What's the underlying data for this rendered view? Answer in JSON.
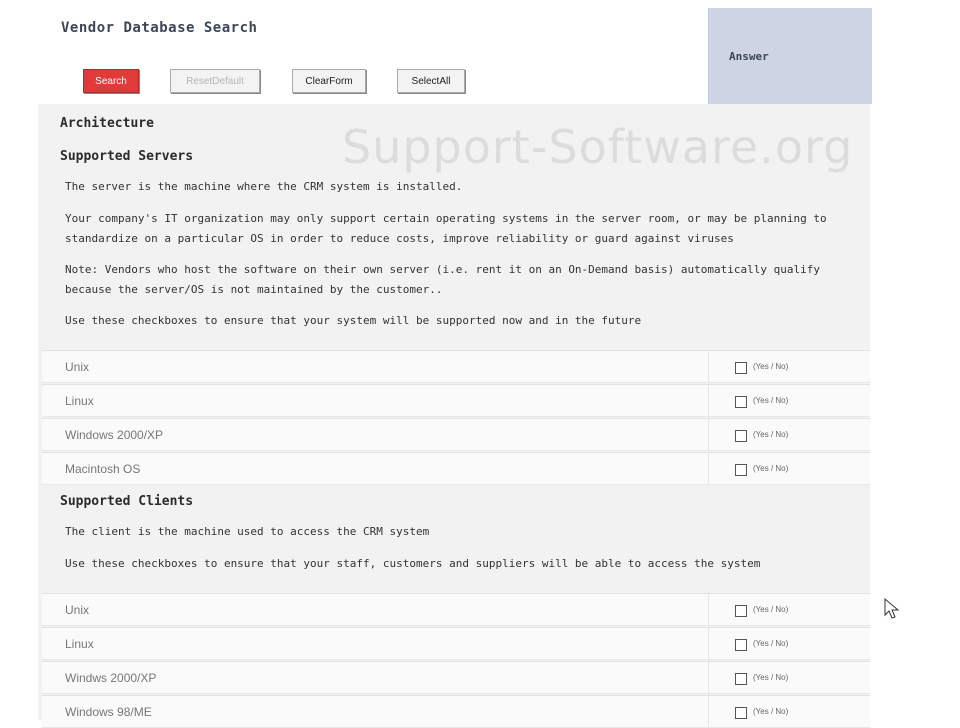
{
  "header": {
    "title": "Vendor Database Search",
    "answer_label": "Answer"
  },
  "toolbar": {
    "search_label": "Search",
    "reset_label": "ResetDefault",
    "clear_label": "ClearForm",
    "select_label": "SelectAll"
  },
  "watermark": "Support-Software.org",
  "architecture": {
    "title": "Architecture"
  },
  "servers": {
    "title": "Supported Servers",
    "para1": "The server is the machine where the CRM system is installed.",
    "para2": "Your company's IT organization may only support certain operating systems in the server room, or may be planning to standardize on a particular OS in order to reduce costs, improve reliability or guard against viruses",
    "para3": "Note: Vendors who host the software on their own server (i.e. rent it on an On-Demand basis) automatically qualify because the server/OS is not maintained by the customer..",
    "para4": "Use these checkboxes to ensure that your system will be supported now and in the future",
    "options": [
      {
        "label": "Unix",
        "yesno": "(Yes / No)"
      },
      {
        "label": "Linux",
        "yesno": "(Yes / No)"
      },
      {
        "label": "Windows 2000/XP",
        "yesno": "(Yes / No)"
      },
      {
        "label": "Macintosh OS",
        "yesno": "(Yes / No)"
      }
    ]
  },
  "clients": {
    "title": "Supported Clients",
    "para1": "The client is the machine used to access the CRM system",
    "para2": "Use these checkboxes to ensure that your staff, customers and suppliers will be able to access the system",
    "options": [
      {
        "label": "Unix",
        "yesno": "(Yes / No)"
      },
      {
        "label": "Linux",
        "yesno": "(Yes / No)"
      },
      {
        "label": "Windws 2000/XP",
        "yesno": "(Yes / No)"
      },
      {
        "label": "Windows 98/ME",
        "yesno": "(Yes / No)"
      }
    ]
  }
}
